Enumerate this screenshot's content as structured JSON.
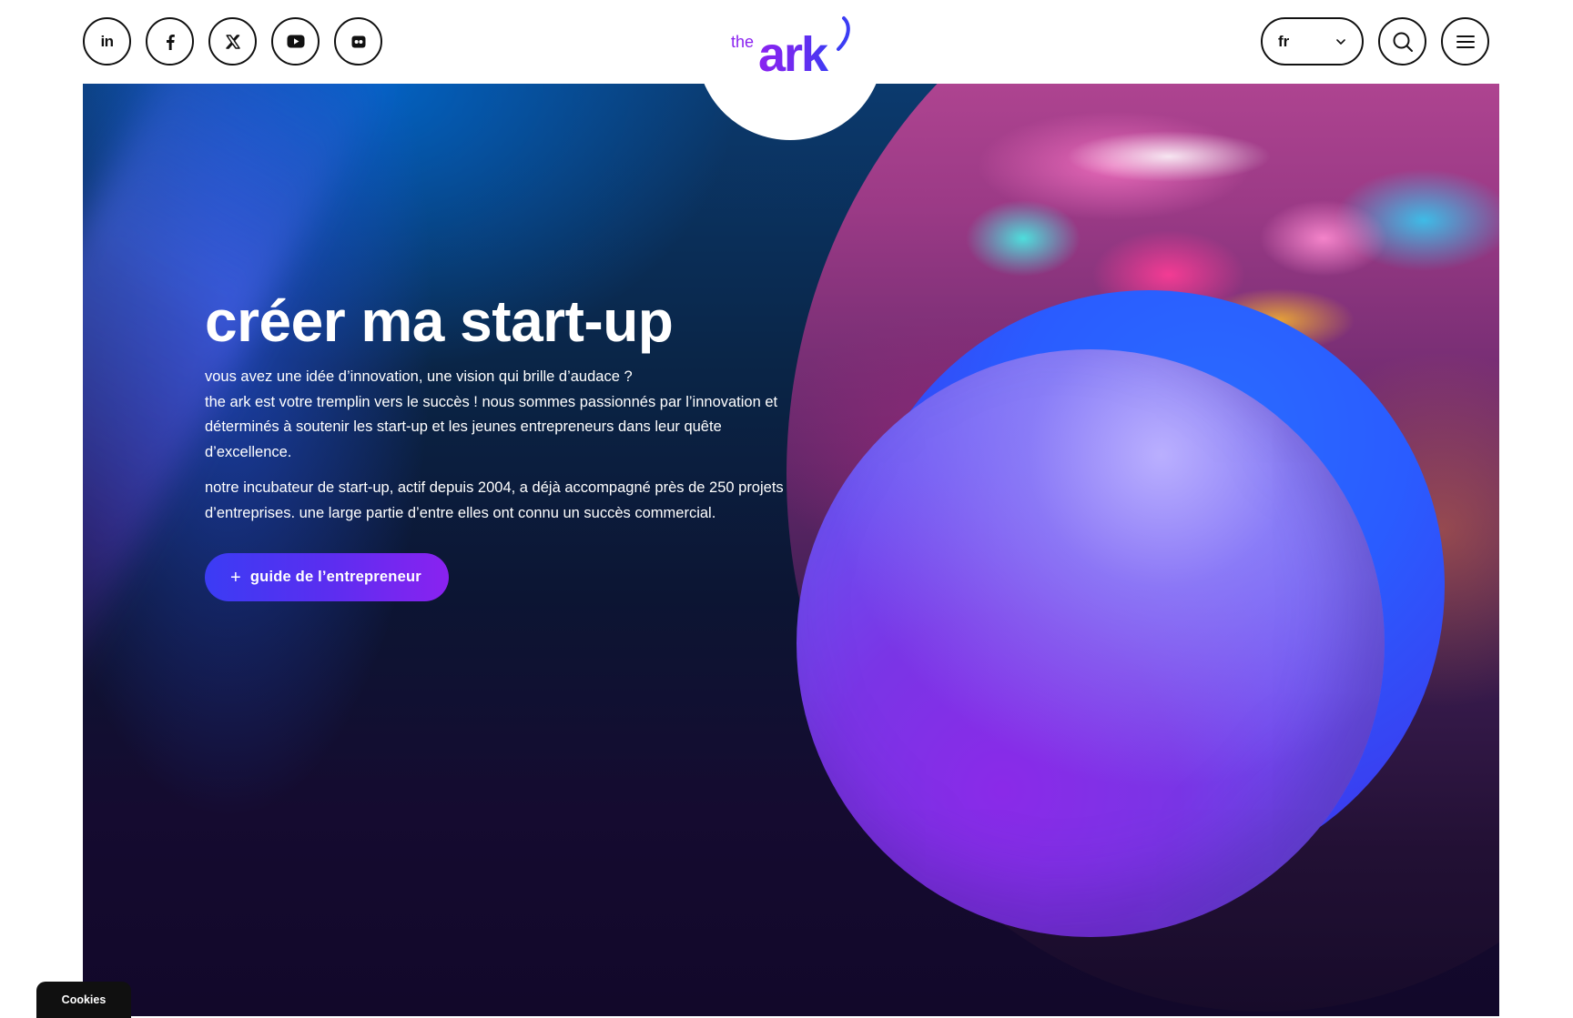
{
  "header": {
    "social": [
      {
        "name": "linkedin",
        "icon": "linkedin-icon",
        "label": "in"
      },
      {
        "name": "facebook",
        "icon": "facebook-icon"
      },
      {
        "name": "x",
        "icon": "x-icon"
      },
      {
        "name": "youtube",
        "icon": "youtube-icon"
      },
      {
        "name": "flickr",
        "icon": "flickr-icon"
      }
    ],
    "logo": {
      "small": "the",
      "main": "ark"
    },
    "language": {
      "selected": "fr",
      "icon": "chevron-down-icon"
    },
    "search_icon": "search-icon",
    "menu_icon": "menu-icon"
  },
  "hero": {
    "title": "créer ma start-up",
    "intro_lines": [
      "vous avez une idée d’innovation, une vision qui brille d’audace ?",
      "the ark est votre tremplin vers le succès ! nous sommes passionnés par l’innovation et",
      "déterminés à soutenir les start-up et les jeunes entrepreneurs dans leur quête",
      "d’excellence."
    ],
    "second_lines": [
      "notre incubateur de start-up, actif depuis 2004, a déjà accompagné près de 250 projets",
      "d’entreprises. une large partie d’entre elles ont connu un succès commercial."
    ],
    "cta": {
      "plus": "+",
      "label": "guide de l’entrepreneur"
    }
  },
  "cookies": {
    "label": "Cookies"
  },
  "colors": {
    "accent": "#5a2ef0",
    "logo_purple": "#8a22f0",
    "logo_blue": "#3b3cf4",
    "text_dark": "#111111"
  }
}
